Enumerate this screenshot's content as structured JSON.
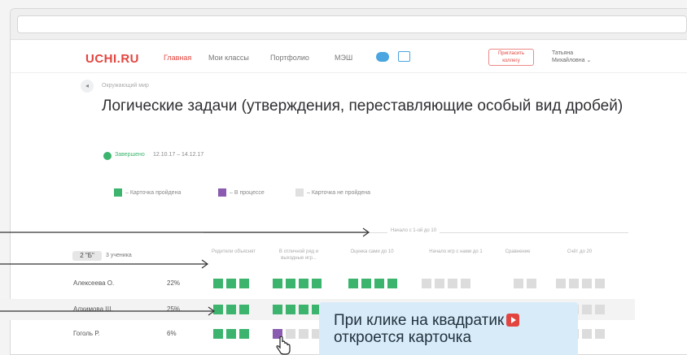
{
  "header": {
    "logo": "UCHI.RU",
    "nav": [
      "Главная",
      "Мои классы",
      "Портфолио",
      "МЭШ"
    ],
    "invite_label": "Пригласить коллегу",
    "user_name_line1": "Татьяна",
    "user_name_line2": "Михайловна ⌄"
  },
  "page": {
    "breadcrumb": "Окружающий мир",
    "title": "Логические задачи (утверждения, переставляющие особый вид дробей)",
    "status": "Завершено",
    "dates": "12.10.17 – 14.12.17"
  },
  "legend": [
    {
      "label": "– Карточка пройдена",
      "color": "#3cb46e"
    },
    {
      "label": "– В процессе",
      "color": "#8a5bb0"
    },
    {
      "label": "– Карточка не пройдена",
      "color": "#e0e0e0"
    }
  ],
  "table": {
    "range_label": "Начало с 1-ой до 10",
    "class_badge": "2 \"Б\"",
    "students_label": "3 ученика",
    "columns": [
      "Родители объяснят",
      "В отличной ряд и выходные игр...",
      "Оценка сами до 10",
      "Начало игр с нами до 1",
      "Сравнение",
      "Счёт до 20"
    ],
    "rows": [
      {
        "name": "Алексеева О.",
        "percent": "22%",
        "cells": [
          "g",
          "g",
          "g",
          "g",
          "g",
          "g",
          "g",
          "g",
          "g",
          "g",
          "g",
          "e",
          "e",
          "e",
          "e",
          "e",
          "e",
          "e",
          "e",
          "e",
          "e"
        ]
      },
      {
        "name": "Алхимова Ш.",
        "percent": "25%",
        "cells": [
          "g",
          "g",
          "g",
          "g",
          "g",
          "g",
          "g",
          "e",
          "e",
          "e",
          "e",
          "e",
          "e",
          "e",
          "e",
          "e",
          "e",
          "e",
          "e",
          "e",
          "e"
        ]
      },
      {
        "name": "Гоголь Р.",
        "percent": "6%",
        "cells": [
          "g",
          "g",
          "g",
          "p",
          "e",
          "e",
          "e",
          "e",
          "e",
          "e",
          "e",
          "e",
          "e",
          "e",
          "e",
          "e",
          "e",
          "e",
          "e",
          "e",
          "e"
        ]
      }
    ],
    "cell_colors": {
      "g": "#3cb46e",
      "p": "#8a5bb0",
      "e": "#dcdcdc"
    }
  },
  "tooltip": {
    "line1": "При клике на квадратик",
    "line2": "откроется карточка",
    "play_icon": "play-icon"
  }
}
